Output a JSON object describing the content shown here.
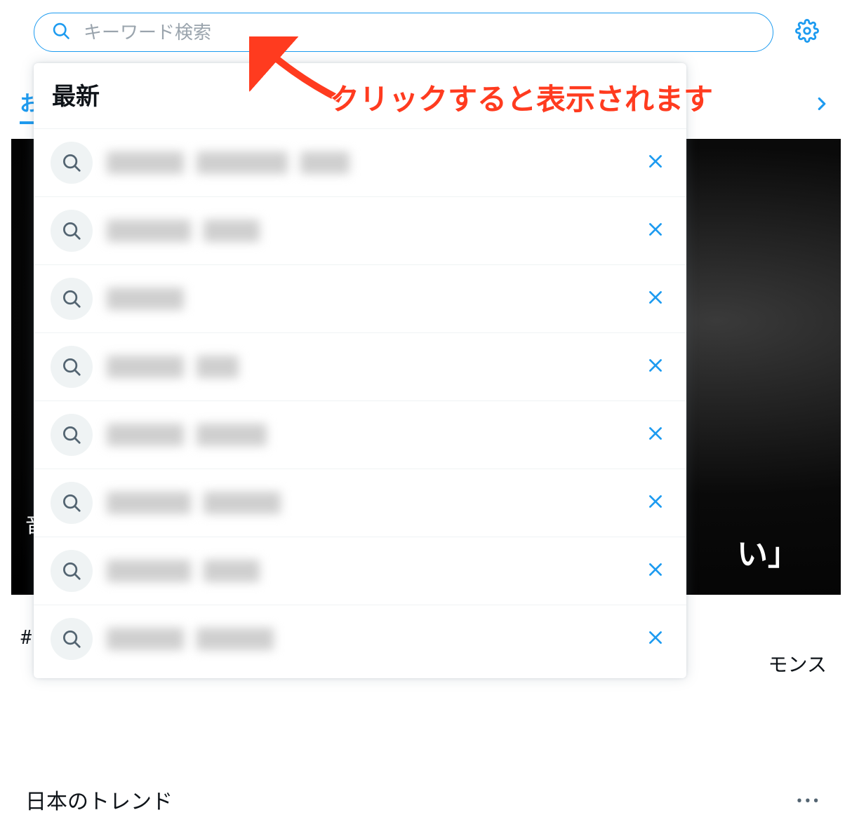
{
  "search": {
    "placeholder": "キーワード検索",
    "value": ""
  },
  "dropdown": {
    "title": "最新",
    "history": [
      {
        "redacted": true
      },
      {
        "redacted": true
      },
      {
        "redacted": true
      },
      {
        "redacted": true
      },
      {
        "redacted": true
      },
      {
        "redacted": true
      },
      {
        "redacted": true
      },
      {
        "redacted": true
      }
    ]
  },
  "annotation": {
    "text": "クリックすると表示されます"
  },
  "background": {
    "nav_left_char": "お",
    "overlay_small": "音",
    "overlay_big_fragment": "い」",
    "trend_hash_fragment": "#",
    "trend_right_fragment": "モンス",
    "bottom_trend_label": "日本のトレンド",
    "more_dots": "•••"
  },
  "icons": {
    "search": "magnifying-glass",
    "gear": "gear",
    "remove": "x",
    "chevron": "chevron-right"
  },
  "colors": {
    "primary": "#1d9bf0",
    "annotation_red": "#ff3b1f"
  }
}
